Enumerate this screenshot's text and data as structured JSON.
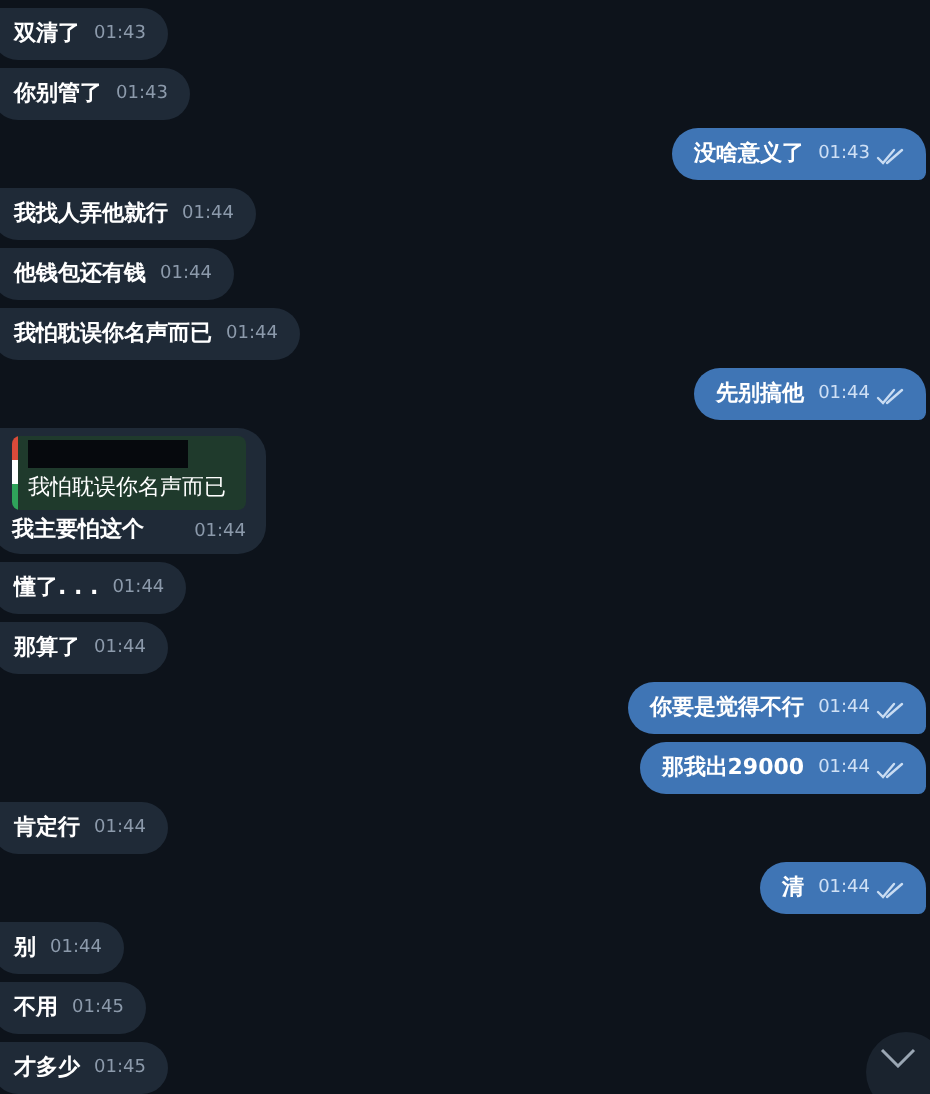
{
  "messages": [
    {
      "outgoing": false,
      "kind": "text",
      "text": "双清了",
      "time": "01:43"
    },
    {
      "outgoing": false,
      "kind": "text",
      "text": "你别管了",
      "time": "01:43"
    },
    {
      "outgoing": true,
      "kind": "text",
      "text": "没啥意义了",
      "time": "01:43",
      "read": true
    },
    {
      "outgoing": false,
      "kind": "text",
      "text": "我找人弄他就行",
      "time": "01:44"
    },
    {
      "outgoing": false,
      "kind": "text",
      "text": "他钱包还有钱",
      "time": "01:44"
    },
    {
      "outgoing": false,
      "kind": "text",
      "text": "我怕耽误你名声而已",
      "time": "01:44"
    },
    {
      "outgoing": true,
      "kind": "text",
      "text": "先别搞他",
      "time": "01:44",
      "read": true
    },
    {
      "outgoing": false,
      "kind": "reply",
      "quote": "我怕耽误你名声而已",
      "text": "我主要怕这个",
      "time": "01:44"
    },
    {
      "outgoing": false,
      "kind": "text",
      "text": "懂了. . .",
      "time": "01:44"
    },
    {
      "outgoing": false,
      "kind": "text",
      "text": "那算了",
      "time": "01:44"
    },
    {
      "outgoing": true,
      "kind": "text",
      "text": "你要是觉得不行",
      "time": "01:44",
      "read": true
    },
    {
      "outgoing": true,
      "kind": "text",
      "text": "那我出29000",
      "time": "01:44",
      "read": true
    },
    {
      "outgoing": false,
      "kind": "text",
      "text": "肯定行",
      "time": "01:44"
    },
    {
      "outgoing": true,
      "kind": "text",
      "text": "清",
      "time": "01:44",
      "read": true
    },
    {
      "outgoing": false,
      "kind": "text",
      "text": "别",
      "time": "01:44"
    },
    {
      "outgoing": false,
      "kind": "text",
      "text": "不用",
      "time": "01:45"
    },
    {
      "outgoing": false,
      "kind": "text",
      "text": "才多少",
      "time": "01:45"
    }
  ]
}
